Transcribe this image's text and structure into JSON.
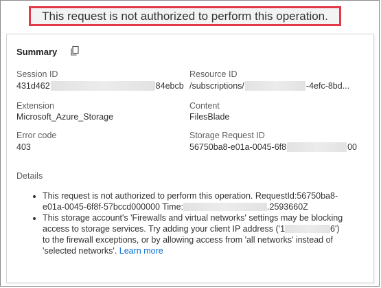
{
  "header": {
    "title": "This request is not authorized to perform this operation."
  },
  "summary": {
    "heading": "Summary",
    "copy_icon": "copy-icon",
    "session_id": {
      "label": "Session ID",
      "prefix": "431d462",
      "suffix": "84ebcb"
    },
    "resource_id": {
      "label": "Resource ID",
      "prefix": "/subscriptions/",
      "suffix": "-4efc-8bd..."
    },
    "extension": {
      "label": "Extension",
      "value": "Microsoft_Azure_Storage"
    },
    "content": {
      "label": "Content",
      "value": "FilesBlade"
    },
    "error_code": {
      "label": "Error code",
      "value": "403"
    },
    "storage_request_id": {
      "label": "Storage Request ID",
      "prefix": "56750ba8-e01a-0045-6f8",
      "suffix": "00"
    }
  },
  "details": {
    "label": "Details",
    "item1": {
      "line1": "This request is not authorized to perform this operation. RequestId:56750ba8-",
      "line2_prefix": "e01a-0045-6f8f-57bccd000000 Time:",
      "line2_suffix": ".2593660Z"
    },
    "item2": {
      "line1": "This storage account's 'Firewalls and virtual networks' settings may be blocking",
      "line2": "access to storage services. Try adding your client IP address ('1",
      "line2_suffix": "6')",
      "line3": "to the firewall exceptions, or by allowing access from 'all networks' instead of",
      "line4": "'selected networks'.",
      "link": "Learn more"
    }
  }
}
